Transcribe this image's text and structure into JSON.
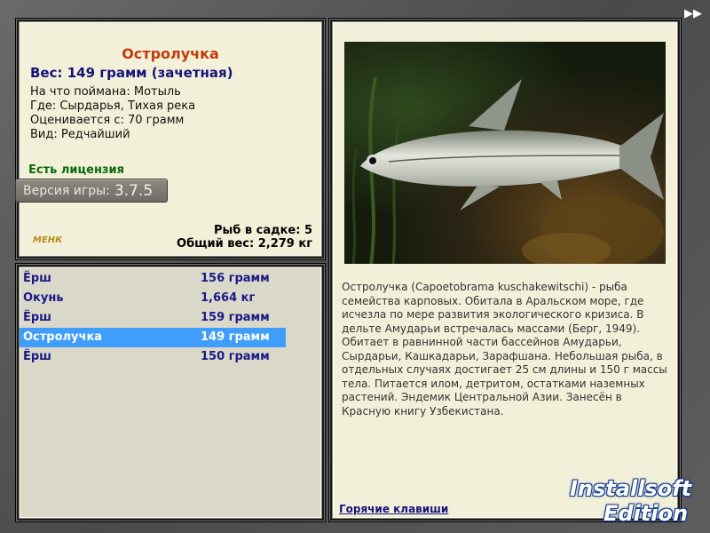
{
  "nav": {
    "next_icon": "double-arrow-right-icon",
    "next_glyph": "▶▶"
  },
  "info": {
    "title": "Остролучка",
    "weight": "Вес: 149 грамм (зачетная)",
    "caught_on": "На что поймана: Мотыль",
    "where": "Где: Сырдарья, Тихая река",
    "valued_from": "Оценивается с: 70 грамм",
    "kind": "Вид: Редчайший",
    "license": "Есть лицензия",
    "version_label": "Версия игры:",
    "version_number": "3.7.5",
    "small_logo": "МЕНК",
    "fish_in_cage": "Рыб в садке: 5",
    "total_weight": "Общий вес: 2,279 кг"
  },
  "catch_list": [
    {
      "name": "Ёрш",
      "weight": "156 грамм",
      "selected": false
    },
    {
      "name": "Окунь",
      "weight": "1,664 кг",
      "selected": false
    },
    {
      "name": "Ёрш",
      "weight": "159 грамм",
      "selected": false
    },
    {
      "name": "Остролучка",
      "weight": "149 грамм",
      "selected": true
    },
    {
      "name": "Ёрш",
      "weight": "150 грамм",
      "selected": false
    }
  ],
  "description": "Остролучка (Capoetobrama kuschakewitschi) - рыба семейства карповых. Обитала в Аральском море, где исчезла по мере развития экологического кризиса. В дельте Амударьи встречалась массами (Берг, 1949). Обитает в равнинной части бассейнов Амударьи, Сырдарьи, Кашкадарьи, Зарафшана. Небольшая рыба, в отдельных случаях достигает 25 см длины и 150 г массы тела. Питается илом, детритом, остатками наземных растений. Эндемик Центральной Азии. Занесён в Красную книгу Узбекистана.",
  "hotkeys": "Горячие клавиши",
  "watermark": {
    "line1": "Installsoft",
    "line2": "Edition"
  },
  "colors": {
    "selected_row": "#3f9dfc",
    "title": "#c23a0a",
    "navy": "#15137a",
    "license": "#0b6a0b"
  }
}
